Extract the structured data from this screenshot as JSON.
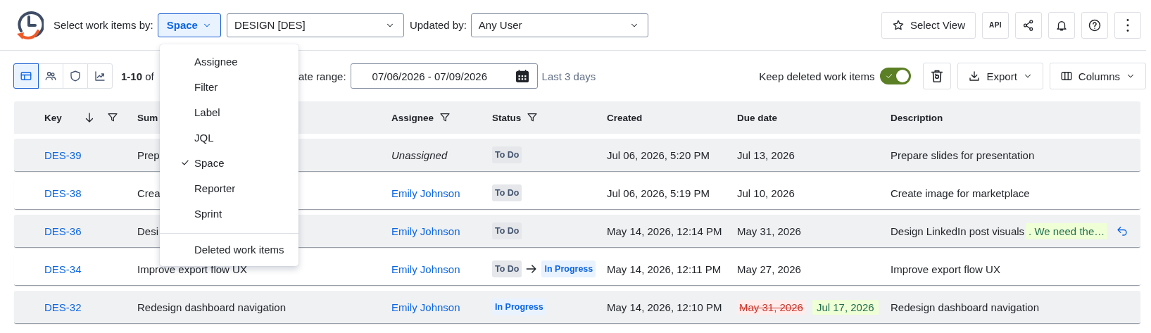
{
  "toolbar": {
    "select_label": "Select work items by:",
    "select_by": {
      "label": "Space",
      "expanded": true
    },
    "space_field": {
      "value": "DESIGN [DES]"
    },
    "updated_label": "Updated by:",
    "updated_field": {
      "value": "Any User"
    },
    "select_view": "Select View",
    "api": "API"
  },
  "menu": {
    "items": [
      {
        "label": "Assignee",
        "selected": false
      },
      {
        "label": "Filter",
        "selected": false
      },
      {
        "label": "Label",
        "selected": false
      },
      {
        "label": "JQL",
        "selected": false
      },
      {
        "label": "Space",
        "selected": true
      },
      {
        "label": "Reporter",
        "selected": false
      },
      {
        "label": "Sprint",
        "selected": false
      }
    ],
    "footer": "Deleted work items"
  },
  "controls": {
    "views": [
      {
        "kind": "table",
        "selected": true
      },
      {
        "kind": "people",
        "selected": false
      },
      {
        "kind": "shield",
        "selected": false
      },
      {
        "kind": "chart",
        "selected": false
      }
    ],
    "count": "**1-10** of",
    "date_label": "ate range:",
    "date_range": "07/06/2026 - 07/09/2026",
    "date_hint": "Last 3 days",
    "keep_deleted": {
      "label": "Keep deleted work items",
      "on": true
    },
    "export": "Export",
    "columns": "Columns"
  },
  "table": {
    "columns": [
      {
        "label": "Key",
        "sortable": true,
        "filter": true
      },
      {
        "label": "Sum",
        "sortable": false,
        "filter": false
      },
      {
        "label": "Assignee",
        "sortable": false,
        "filter": true
      },
      {
        "label": "Status",
        "sortable": false,
        "filter": true
      },
      {
        "label": "Created",
        "sortable": false,
        "filter": false
      },
      {
        "label": "Due date",
        "sortable": false,
        "filter": false
      },
      {
        "label": "Description",
        "sortable": false,
        "filter": false
      }
    ],
    "rows": [
      {
        "key": "DES-39",
        "summary": "Prep",
        "assignee": {
          "text": "Unassigned",
          "kind": "none"
        },
        "status": [
          {
            "label": "To Do",
            "kind": "todo"
          }
        ],
        "created": "Jul 06, 2026, 5:20 PM",
        "due": [
          {
            "text": "Jul 13, 2026",
            "kind": "plain"
          }
        ],
        "description": "Prepare slides for presentation",
        "revertable": false
      },
      {
        "key": "DES-38",
        "summary": "Crea",
        "assignee": {
          "text": "Emily Johnson",
          "kind": "user"
        },
        "status": [
          {
            "label": "To Do",
            "kind": "todo"
          }
        ],
        "created": "Jul 06, 2026, 5:19 PM",
        "due": [
          {
            "text": "Jul 10, 2026",
            "kind": "plain"
          }
        ],
        "description": "Create image for marketplace",
        "revertable": false
      },
      {
        "key": "DES-36",
        "summary": "Desi",
        "assignee": {
          "text": "Emily Johnson",
          "kind": "user"
        },
        "status": [
          {
            "label": "To Do",
            "kind": "todo"
          }
        ],
        "created": "May 14, 2026, 12:14 PM",
        "due": [
          {
            "text": "May 31, 2026",
            "kind": "plain"
          }
        ],
        "description": "Design LinkedIn post visuals",
        "description_added": ". We need the…",
        "revertable": true
      },
      {
        "key": "DES-34",
        "summary": "Improve export flow UX",
        "assignee": {
          "text": "Emily Johnson",
          "kind": "user"
        },
        "status": [
          {
            "label": "To Do",
            "kind": "todo"
          },
          {
            "label": "In Progress",
            "kind": "progress"
          }
        ],
        "created": "May 14, 2026, 12:11 PM",
        "due": [
          {
            "text": "May 27, 2026",
            "kind": "plain"
          }
        ],
        "description": "Improve export flow UX",
        "revertable": false
      },
      {
        "key": "DES-32",
        "summary": "Redesign dashboard navigation",
        "assignee": {
          "text": "Emily Johnson",
          "kind": "user"
        },
        "status": [
          {
            "label": "In Progress",
            "kind": "progress"
          }
        ],
        "created": "May 14, 2026, 12:10 PM",
        "due": [
          {
            "text": "May 31, 2026",
            "kind": "removed"
          },
          {
            "text": "Jul 17, 2026",
            "kind": "added"
          }
        ],
        "description": "Redesign dashboard navigation",
        "revertable": false
      }
    ]
  }
}
